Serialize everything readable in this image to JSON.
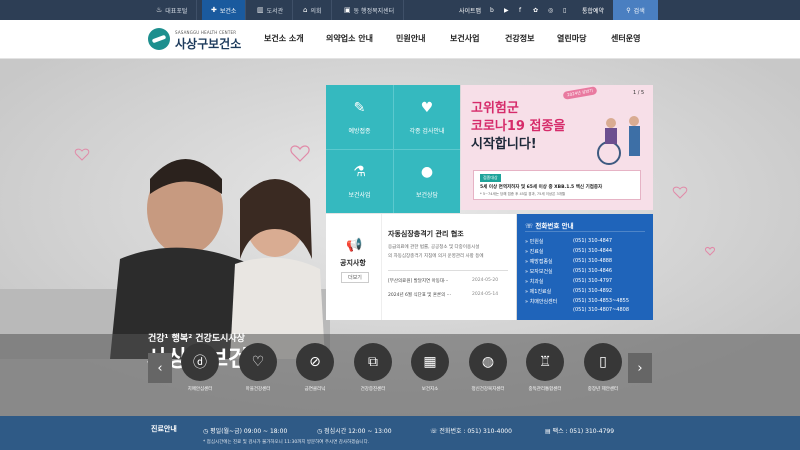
{
  "topbar": {
    "links": [
      {
        "label": "대표포털",
        "icon": "portal-icon"
      },
      {
        "label": "보건소",
        "icon": "health-cross-icon"
      },
      {
        "label": "도서관",
        "icon": "book-icon"
      },
      {
        "label": "의회",
        "icon": "council-icon"
      },
      {
        "label": "동 행정복지센터",
        "icon": "office-icon"
      }
    ],
    "sitemap": "사이트맵",
    "sns": [
      "blog",
      "youtube",
      "facebook",
      "kakao",
      "instagram"
    ],
    "integrated_reservation": "통합예약",
    "search_label": "검색"
  },
  "header": {
    "logo_eng": "SASANGGU HEALTH CENTER",
    "logo_kor": "사상구보건소",
    "nav": [
      "보건소 소개",
      "의약업소 안내",
      "민원안내",
      "보건사업",
      "건강정보",
      "열린마당",
      "센터운영"
    ]
  },
  "hero": {
    "caption_small": "건강¹ 행복² 건강도시사상",
    "caption_large": "사상구보건소"
  },
  "tiles": [
    {
      "label": "예방접종",
      "icon": "syringe-icon"
    },
    {
      "label": "각종 검사안내",
      "icon": "heartbeat-icon"
    },
    {
      "label": "보건사업",
      "icon": "medicine-bowl-icon"
    },
    {
      "label": "보건상담",
      "icon": "counsel-icon"
    }
  ],
  "banner": {
    "page": "1 / 5",
    "tag": "2024년 상반기",
    "line1": "고위험군",
    "line2": "코로나19 접종을",
    "line3": "시작합니다!",
    "box_label": "접종대상",
    "box_text": "5세 이상 면역저하자 및 65세 이상 중 XBB.1.5 백신 기접종자",
    "box_small": "* 5~74세는 당해 접종 후 45일 경과, 75세 이상은 3개월"
  },
  "notice": {
    "label": "공지사항",
    "more": "더보기",
    "title": "자동심장충격기 관리 협조",
    "body": [
      "응급의료에 관한 법률, 공공청소 및 다중이용시설",
      "의 자동심장충격기 지침에 의거 운영관리 사항 등에"
    ],
    "items": [
      {
        "text": "[부산의료원] 발달지연 아동대···",
        "date": "2024-05-20"
      },
      {
        "text": "2024년 6월 식단표 및 혼론의 ···",
        "date": "2024-05-14"
      }
    ]
  },
  "phone": {
    "title": "전화번호 안내",
    "rows": [
      {
        "name": "민원실",
        "num": "(051) 310-4847"
      },
      {
        "name": "진료실",
        "num": "(051) 310-4844"
      },
      {
        "name": "예방접종실",
        "num": "(051) 310-4888"
      },
      {
        "name": "모자보건실",
        "num": "(051) 310-4846"
      },
      {
        "name": "치과실",
        "num": "(051) 310-4797"
      },
      {
        "name": "제1진료실",
        "num": "(051) 310-4892"
      },
      {
        "name": "치매안심센터",
        "num": "(051) 310-4853~4855"
      },
      {
        "name": "",
        "num": "(051) 310-4807~4808"
      }
    ]
  },
  "quick": [
    {
      "label": "치매안심센터",
      "icon": "dementia-icon"
    },
    {
      "label": "마을건강센터",
      "icon": "heart-icon"
    },
    {
      "label": "금연클리닉",
      "icon": "no-smoking-icon"
    },
    {
      "label": "건강증진센터",
      "icon": "dumbbell-icon"
    },
    {
      "label": "보건지소",
      "icon": "building-icon"
    },
    {
      "label": "정신건강복지센터",
      "icon": "brain-icon"
    },
    {
      "label": "중독관리통합센터",
      "icon": "glass-icon"
    },
    {
      "label": "중장년 제안센터",
      "icon": "phone-icon"
    }
  ],
  "footer": {
    "title": "진료안내",
    "weekday": "평일(월~금) 09:00 ~ 18:00",
    "lunch": "점심시간 12:00 ~ 13:00",
    "tel": "전화번호 : 051) 310-4000",
    "fax": "팩스 : 051) 310-4799",
    "note": "* 점심시간에는 진료 및 검사가 불가하오니 11:30까지 방문하여 주시면 감사하겠습니다."
  },
  "colors": {
    "teal": "#35b9bf",
    "navy": "#2d3e55",
    "blue": "#1f64ba",
    "footer": "#2f5a86",
    "pink": "#d62b6a"
  }
}
